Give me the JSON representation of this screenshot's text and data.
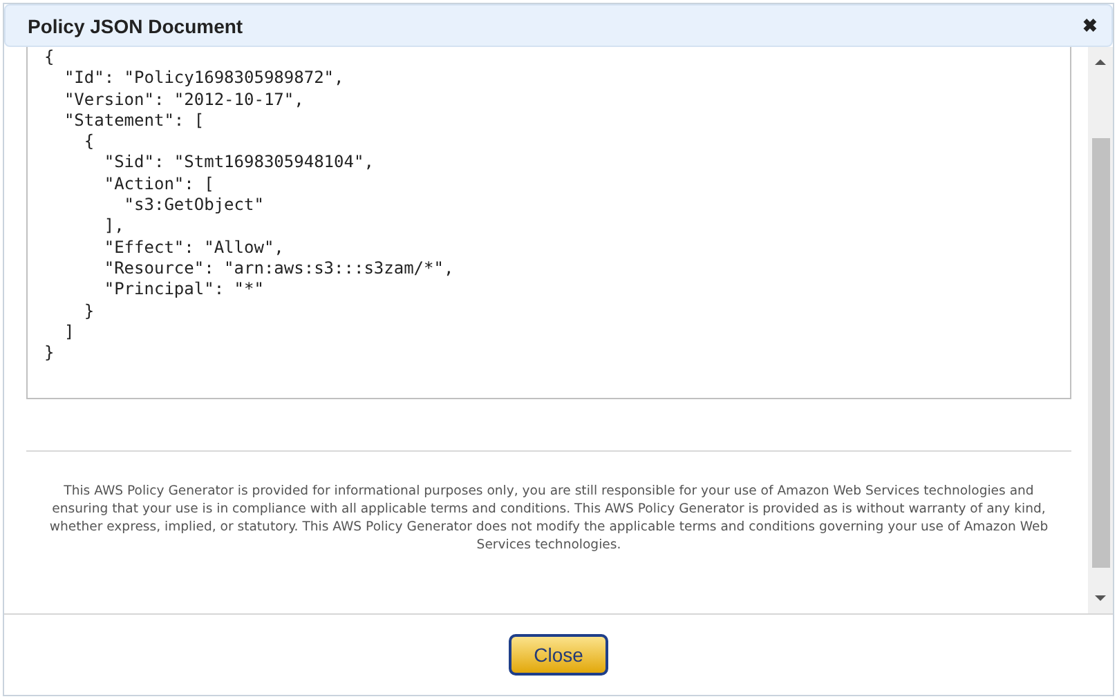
{
  "dialog": {
    "title": "Policy JSON Document",
    "close_icon": "✖"
  },
  "code_lines": [
    "{",
    "  \"Id\": \"Policy1698305989872\",",
    "  \"Version\": \"2012-10-17\",",
    "  \"Statement\": [",
    "    {",
    "      \"Sid\": \"Stmt1698305948104\",",
    "      \"Action\": [",
    "        \"s3:GetObject\"",
    "      ],",
    "      \"Effect\": \"Allow\",",
    "      \"Resource\": \"arn:aws:s3:::s3zam/*\",",
    "      \"Principal\": \"*\"",
    "    }",
    "  ]",
    "}"
  ],
  "disclaimer": "This AWS Policy Generator is provided for informational purposes only, you are still responsible for your use of Amazon Web Services technologies and ensuring that your use is in compliance with all applicable terms and conditions. This AWS Policy Generator is provided as is without warranty of any kind, whether express, implied, or statutory. This AWS Policy Generator does not modify the applicable terms and conditions governing your use of Amazon Web Services technologies.",
  "buttons": [
    "Close"
  ]
}
